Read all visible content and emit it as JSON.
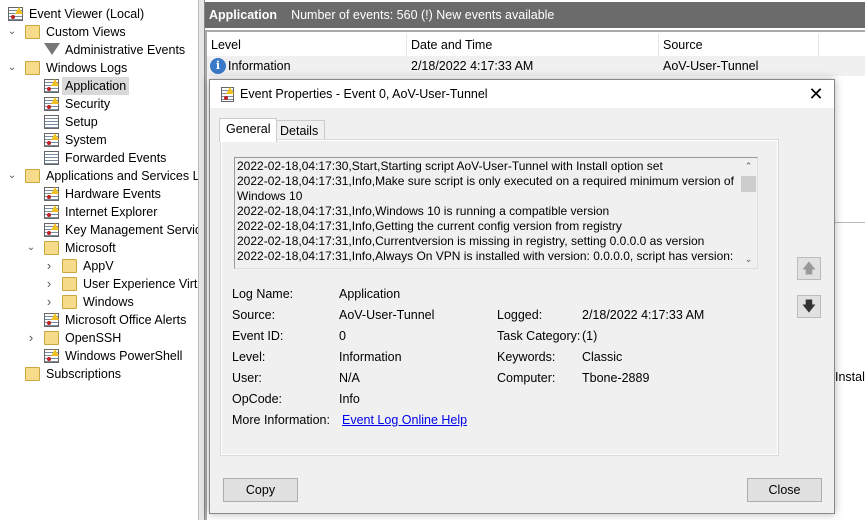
{
  "tree": {
    "items": [
      {
        "label": "Event Viewer (Local)",
        "icon": "event-viewer-icon"
      },
      {
        "label": "Custom Views",
        "icon": "folder-icon",
        "expanded": true
      },
      {
        "label": "Administrative Events",
        "icon": "filter-icon"
      },
      {
        "label": "Windows Logs",
        "icon": "folder-icon",
        "expanded": true
      },
      {
        "label": "Application",
        "icon": "log-warning-icon",
        "selected": true
      },
      {
        "label": "Security",
        "icon": "log-warning-icon"
      },
      {
        "label": "Setup",
        "icon": "log-icon"
      },
      {
        "label": "System",
        "icon": "log-warning-icon"
      },
      {
        "label": "Forwarded Events",
        "icon": "log-icon"
      },
      {
        "label": "Applications and Services Lo",
        "icon": "folder-icon",
        "expanded": true
      },
      {
        "label": "Hardware Events",
        "icon": "log-warning-icon"
      },
      {
        "label": "Internet Explorer",
        "icon": "log-warning-icon"
      },
      {
        "label": "Key Management Service",
        "icon": "log-warning-icon"
      },
      {
        "label": "Microsoft",
        "icon": "folder-icon",
        "expanded": true
      },
      {
        "label": "AppV",
        "icon": "folder-icon",
        "expanded": false
      },
      {
        "label": "User Experience Virtu",
        "icon": "folder-icon",
        "expanded": false
      },
      {
        "label": "Windows",
        "icon": "folder-icon",
        "expanded": false
      },
      {
        "label": "Microsoft Office Alerts",
        "icon": "log-warning-icon"
      },
      {
        "label": "OpenSSH",
        "icon": "folder-icon",
        "expanded": false
      },
      {
        "label": "Windows PowerShell",
        "icon": "log-warning-icon"
      },
      {
        "label": "Subscriptions",
        "icon": "folder-icon"
      }
    ]
  },
  "header": {
    "title": "Application",
    "status": "Number of events: 560 (!) New events available"
  },
  "list": {
    "columns": [
      "Level",
      "Date and Time",
      "Source"
    ],
    "rows": [
      {
        "level": "Information",
        "date": "2/18/2022 4:17:33 AM",
        "source": "AoV-User-Tunnel"
      }
    ],
    "partial_text": "Install"
  },
  "dialog": {
    "title": "Event Properties - Event 0, AoV-User-Tunnel",
    "tabs": [
      "General",
      "Details"
    ],
    "description": [
      "2022-02-18,04:17:30,Start,Starting script AoV-User-Tunnel with Install option set",
      "2022-02-18,04:17:31,Info,Make sure script is only executed on a required minimum version of Windows 10",
      "2022-02-18,04:17:31,Info,Windows 10 is running a compatible version",
      "2022-02-18,04:17:31,Info,Getting the current config version from registry",
      "2022-02-18,04:17:31,Info,Currentversion is missing in registry, setting 0.0.0.0 as version",
      "2022-02-18,04:17:31,Info,Always On VPN is installed with version: 0.0.0.0, script has version:"
    ],
    "fields": {
      "log_name": {
        "label": "Log Name:",
        "value": "Application"
      },
      "source": {
        "label": "Source:",
        "value": "AoV-User-Tunnel"
      },
      "logged": {
        "label": "Logged:",
        "value": "2/18/2022 4:17:33 AM"
      },
      "event_id": {
        "label": "Event ID:",
        "value": "0"
      },
      "task_category": {
        "label": "Task Category:",
        "value": "(1)"
      },
      "level": {
        "label": "Level:",
        "value": "Information"
      },
      "keywords": {
        "label": "Keywords:",
        "value": "Classic"
      },
      "user": {
        "label": "User:",
        "value": "N/A"
      },
      "computer": {
        "label": "Computer:",
        "value": "Tbone-2889"
      },
      "opcode": {
        "label": "OpCode:",
        "value": "Info"
      },
      "more_info": {
        "label": "More Information:",
        "value": "Event Log Online Help"
      }
    },
    "copy_label": "Copy",
    "close_label": "Close"
  }
}
